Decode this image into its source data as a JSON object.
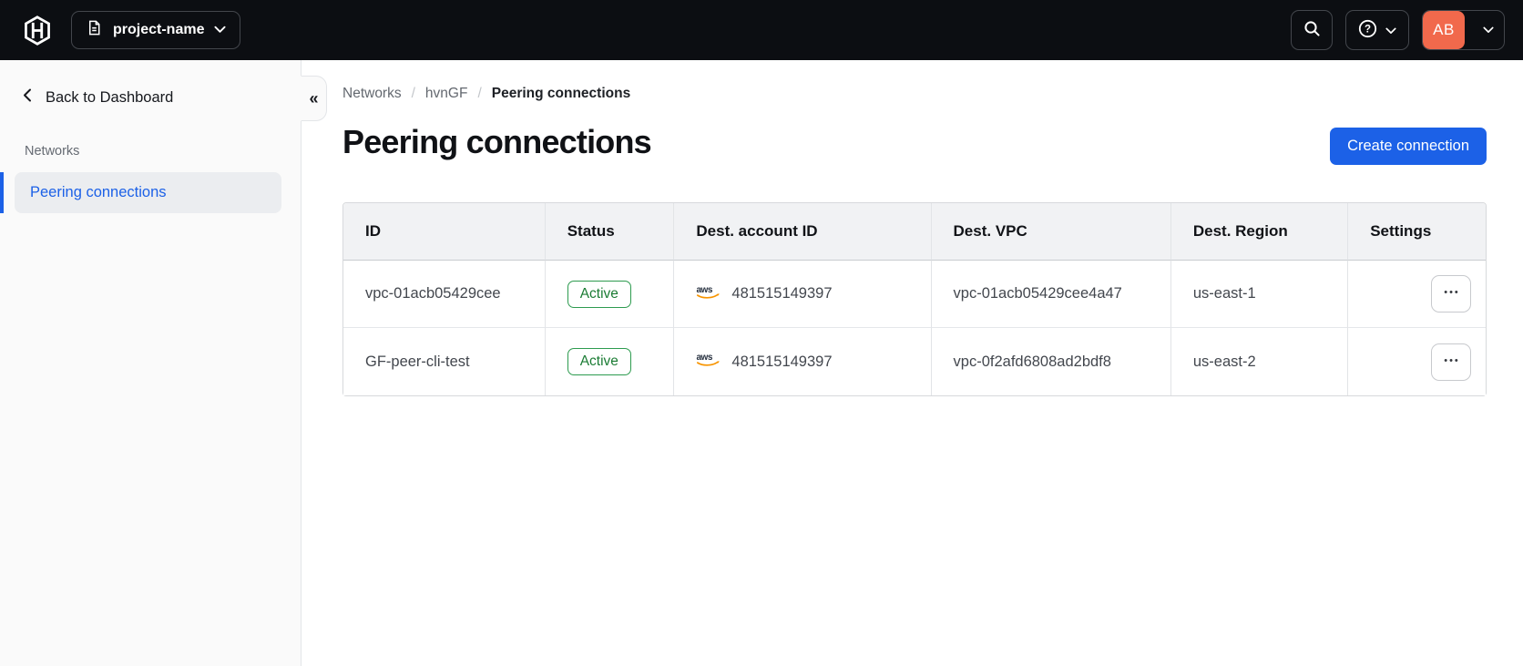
{
  "topbar": {
    "project_name": "project-name",
    "avatar_initials": "AB"
  },
  "sidebar": {
    "back_label": "Back to Dashboard",
    "section_label": "Networks",
    "active_item": "Peering connections",
    "collapse_glyph": "«"
  },
  "breadcrumb": {
    "items": [
      "Networks",
      "hvnGF",
      "Peering connections"
    ],
    "separator": "/"
  },
  "page": {
    "title": "Peering connections",
    "create_button_label": "Create connection"
  },
  "table": {
    "columns": [
      "ID",
      "Status",
      "Dest. account ID",
      "Dest. VPC",
      "Dest. Region",
      "Settings"
    ],
    "rows": [
      {
        "id": "vpc-01acb05429cee",
        "status": "Active",
        "account_id": "481515149397",
        "vpc": "vpc-01acb05429cee4a47",
        "region": "us-east-1"
      },
      {
        "id": "GF-peer-cli-test",
        "status": "Active",
        "account_id": "481515149397",
        "vpc": "vpc-0f2afd6808ad2bdf8",
        "region": "us-east-2"
      }
    ]
  },
  "icons": {
    "logo": "hashicorp-logo",
    "project": "document-icon",
    "search": "magnifying-glass",
    "help": "question-circle",
    "chevron_down": "chevron-down",
    "back": "chevron-left",
    "collapse": "double-chevron-left",
    "aws": "aws-logo",
    "ellipsis": "•••"
  },
  "colors": {
    "topbar_bg": "#0c0e12",
    "accent_blue": "#1c61e7",
    "avatar_bg": "#f1694c",
    "badge_green_border": "#2d9b4f",
    "badge_green_text": "#1b7c34",
    "aws_orange": "#f79400",
    "sidebar_bg": "#fafafa",
    "table_header_bg": "#f1f2f4"
  }
}
